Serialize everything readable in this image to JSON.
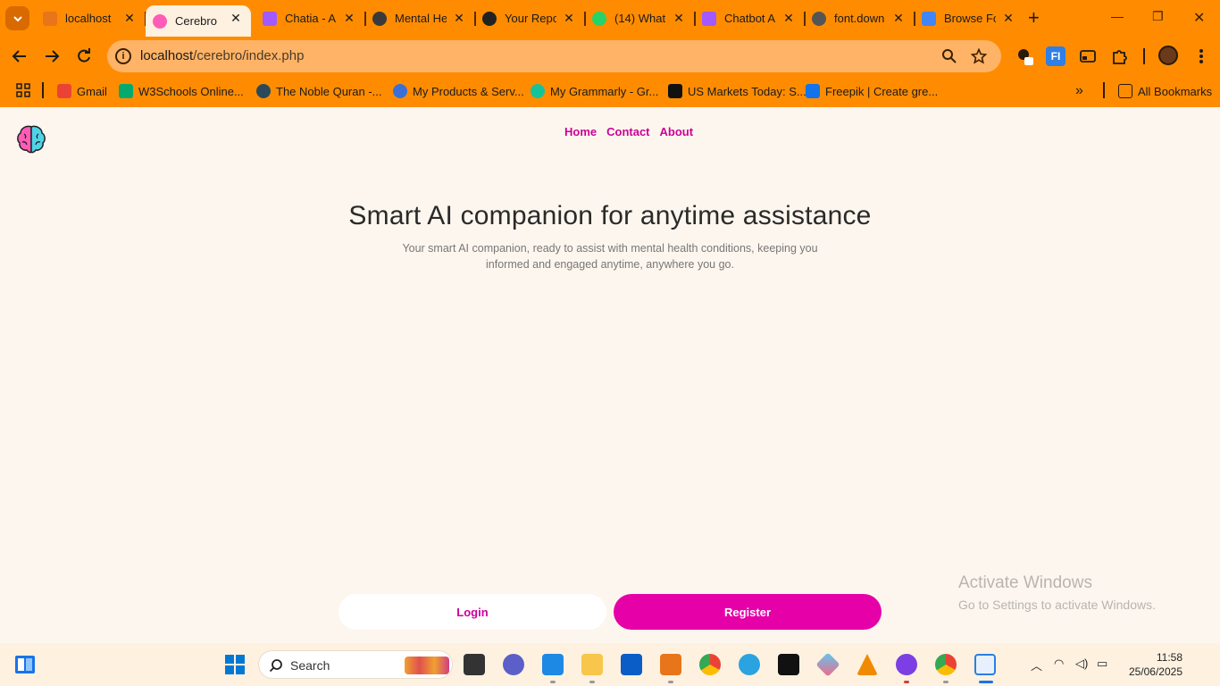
{
  "browser": {
    "tabs": [
      {
        "title": "localhost",
        "icon": "xampp-icon",
        "active": false
      },
      {
        "title": "Cerebro",
        "icon": "brain-icon",
        "active": true
      },
      {
        "title": "Chatia - A",
        "icon": "figma-icon",
        "active": false
      },
      {
        "title": "Mental He",
        "icon": "openai-icon",
        "active": false
      },
      {
        "title": "Your Repo",
        "icon": "github-icon",
        "active": false
      },
      {
        "title": "(14) What",
        "icon": "whatsapp-icon",
        "active": false
      },
      {
        "title": "Chatbot A",
        "icon": "figma-icon",
        "active": false
      },
      {
        "title": "font.down",
        "icon": "globe-icon",
        "active": false
      },
      {
        "title": "Browse Fo",
        "icon": "google-fonts-icon",
        "active": false
      }
    ],
    "address": {
      "host": "localhost",
      "path": "/cerebro/index.php"
    },
    "bookmarks": [
      {
        "label": "Gmail",
        "icon": "gmail-icon"
      },
      {
        "label": "W3Schools Online...",
        "icon": "w3schools-icon"
      },
      {
        "label": "The Noble Quran -...",
        "icon": "quran-icon"
      },
      {
        "label": "My Products & Serv...",
        "icon": "products-icon"
      },
      {
        "label": "My Grammarly - Gr...",
        "icon": "grammarly-icon"
      },
      {
        "label": "US Markets Today: S...",
        "icon": "tradingview-icon"
      },
      {
        "label": "Freepik | Create gre...",
        "icon": "freepik-icon"
      }
    ],
    "all_bookmarks_label": "All Bookmarks",
    "ext_label": "FI"
  },
  "page": {
    "nav": [
      "Home",
      "Contact",
      "About"
    ],
    "title": "Smart AI companion for anytime assistance",
    "subtitle": "Your smart AI companion, ready to assist with mental health conditions, keeping you informed and engaged anytime, anywhere you go.",
    "login_label": "Login",
    "register_label": "Register",
    "watermark_line1": "Activate Windows",
    "watermark_line2": "Go to Settings to activate Windows.",
    "accent_color": "#e600a8"
  },
  "taskbar": {
    "search_label": "Search",
    "time": "11:58",
    "date": "25/06/2025"
  }
}
